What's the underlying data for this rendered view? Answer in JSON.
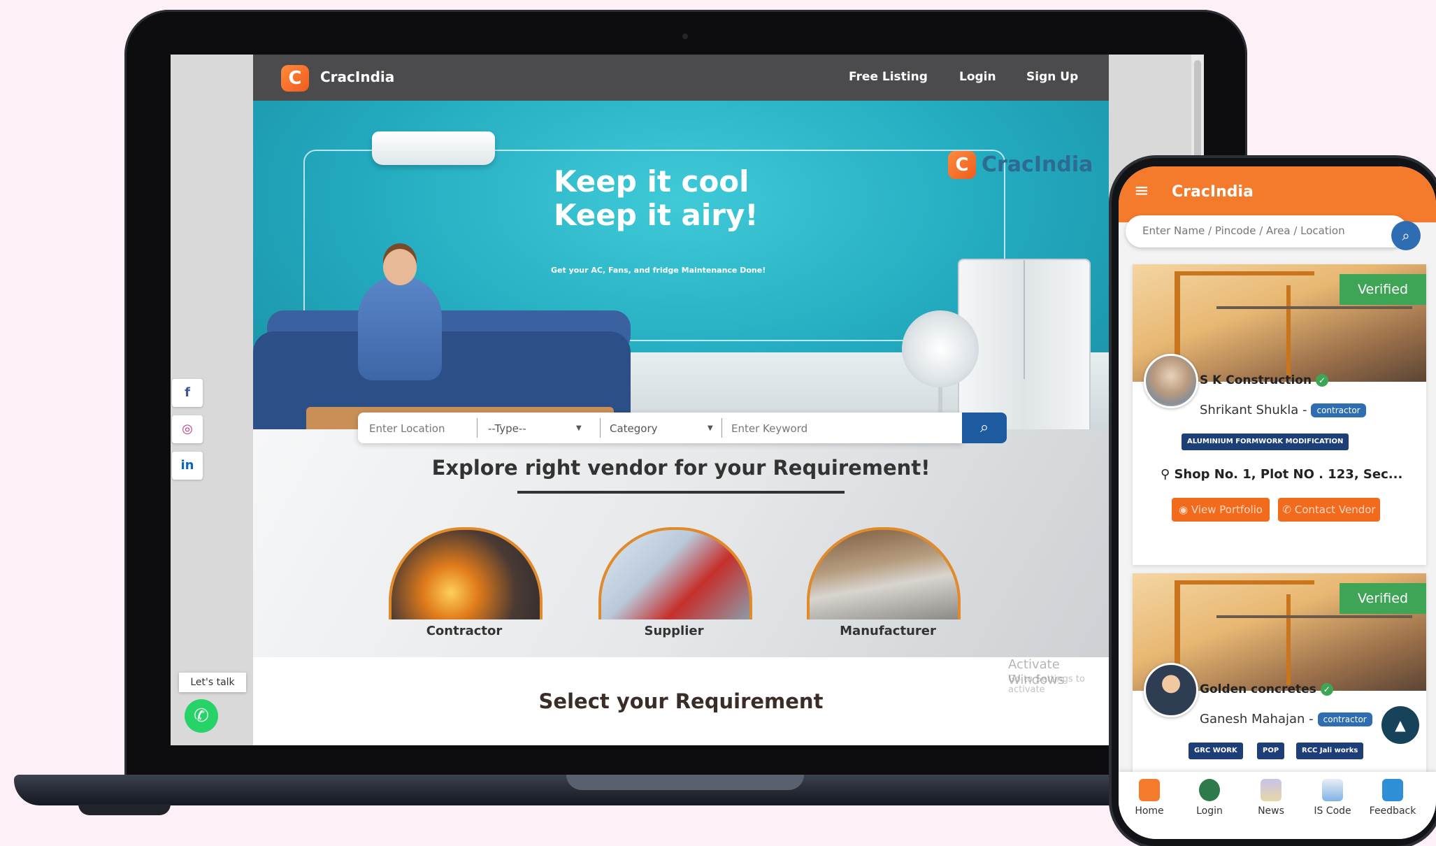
{
  "site": {
    "brand": "CracIndia",
    "logo_glyph": "C",
    "nav_links": {
      "free_listing": "Free Listing",
      "login": "Login",
      "signup": "Sign Up"
    }
  },
  "hero": {
    "title": "Keep it cool\nKeep it airy!",
    "subtitle": "Get your AC, Fans, and fridge Maintenance Done!",
    "brand": "CracIndia"
  },
  "search": {
    "location_placeholder": "Enter Location",
    "type_label": "--Type--",
    "category_label": "Category",
    "keyword_placeholder": "Enter Keyword"
  },
  "explore": {
    "title": "Explore right vendor for your Requirement!",
    "categories": [
      "Contractor",
      "Supplier",
      "Manufacturer"
    ]
  },
  "select": {
    "title": "Select your Requirement"
  },
  "windows_watermark": {
    "title": "Activate Windows",
    "subtitle": "Go to Settings to activate"
  },
  "social": {
    "facebook": "f",
    "instagram": "◎",
    "linkedin": "in"
  },
  "chat": {
    "label": "Let's talk"
  },
  "app": {
    "title": "CracIndia",
    "search_placeholder": "Enter Name / Pincode / Area / Location",
    "vendors": [
      {
        "badge": "Verified",
        "name": "S K Construction",
        "owner": "Shrikant Shukla -",
        "role": "contractor",
        "tags": [
          "ALUMINIUM FORMWORK MODIFICATION"
        ],
        "address": "Shop No. 1, Plot NO . 123, Sec...",
        "portfolio_label": "View Portfolio",
        "contact_label": "Contact Vendor"
      },
      {
        "badge": "Verified",
        "name": "Golden concretes",
        "owner": "Ganesh Mahajan -",
        "role": "contractor",
        "tags": [
          "GRC WORK",
          "POP",
          "RCC Jali works"
        ]
      }
    ],
    "bottom_nav": [
      "Home",
      "Login",
      "News",
      "IS Code",
      "Feedback"
    ]
  },
  "colors": {
    "brand_orange": "#f47a2c",
    "nav_gray": "#4b4b4d",
    "hero_teal": "#22a9be",
    "accent_blue": "#2f6db3",
    "verified_green": "#3fa556"
  }
}
